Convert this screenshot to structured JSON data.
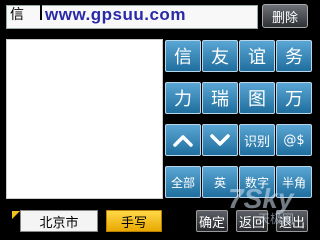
{
  "input": {
    "value": "信",
    "watermark": "www.gpsuu.com"
  },
  "toolbar": {
    "delete_label": "删除"
  },
  "candidates": {
    "row1": [
      "信",
      "友",
      "谊",
      "务"
    ],
    "row2": [
      "力",
      "瑞",
      "图",
      "万"
    ],
    "recognize_label": "识别",
    "symbols_label": "@$",
    "row4": [
      "全部",
      "英",
      "数字",
      "半角"
    ]
  },
  "bottom": {
    "city_label": "北京市",
    "handwrite_label": "手写",
    "confirm_label": "确定",
    "back_label": "返回",
    "exit_label": "退出",
    "watermark": "7Sky",
    "watermark_sub": "天极网"
  },
  "colors": {
    "candidate_blue": "#2f88c0",
    "handwrite_yellow": "#f2c21a",
    "watermark_blue": "#2a2aa8"
  }
}
